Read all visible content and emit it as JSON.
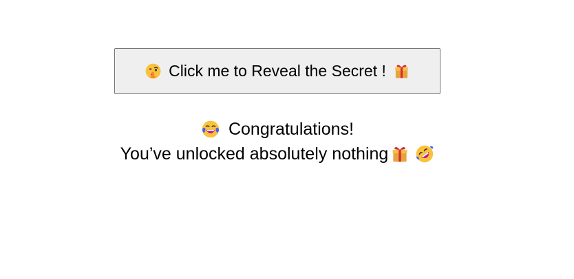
{
  "reveal_button": {
    "leading_icon": "shushing-face-icon",
    "label": "Click me to Reveal the Secret !",
    "trailing_icon": "gift-icon"
  },
  "message": {
    "line1_icon": "laughing-tears-face-icon",
    "line1_text": "Congratulations!",
    "line2_text": "You’ve unlocked absolutely nothing",
    "line2_icons": [
      "gift-icon",
      "rolling-on-floor-laughing-icon"
    ]
  },
  "colors": {
    "button_background": "#efefef",
    "button_border": "#767676",
    "text": "#000000",
    "page_background": "#ffffff"
  }
}
